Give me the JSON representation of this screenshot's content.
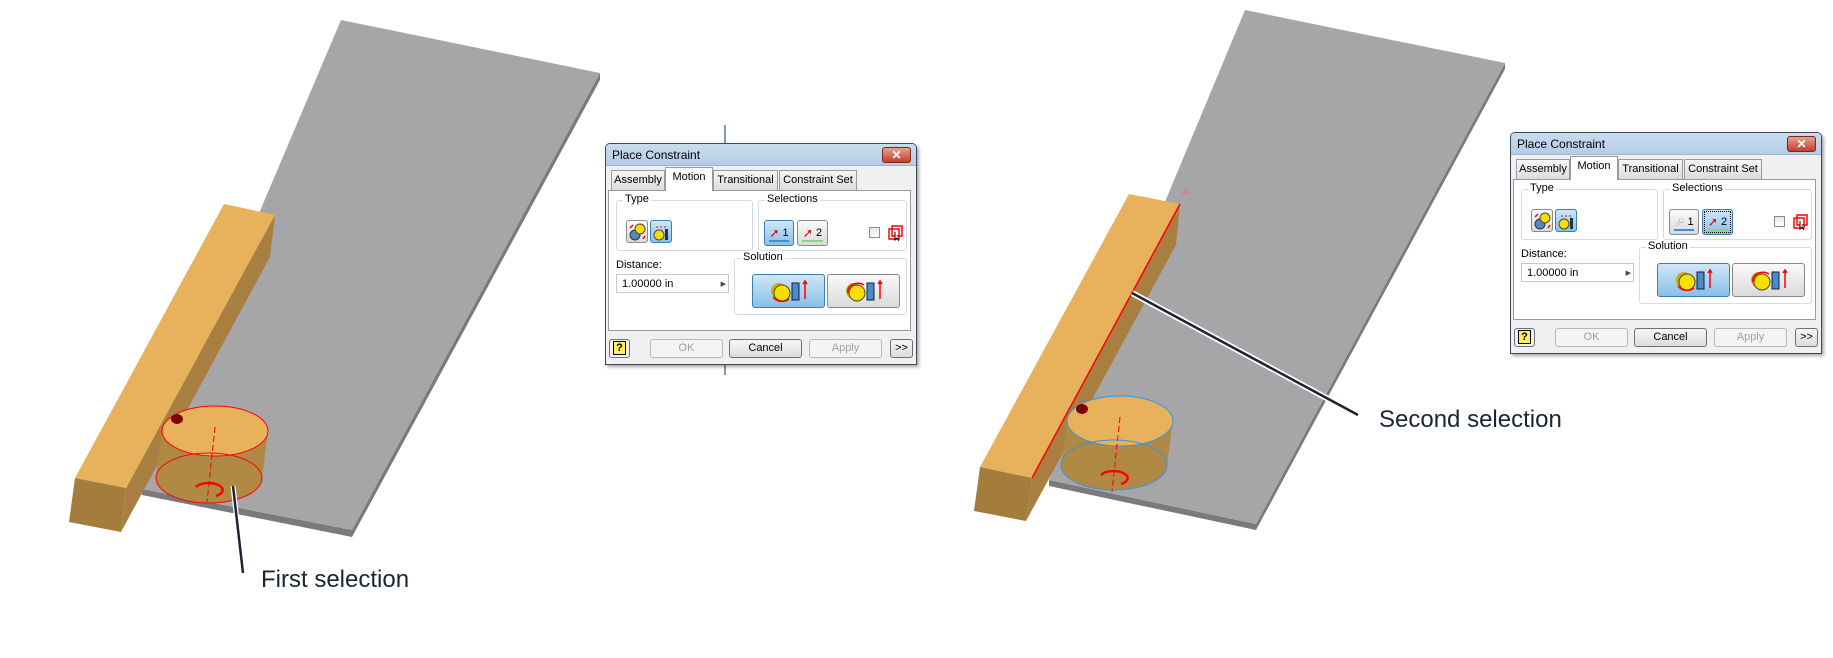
{
  "captions": {
    "first": "First selection",
    "second": "Second selection"
  },
  "colors": {
    "plate": "#a6a6a8",
    "bar_top": "#e8b25c",
    "bar_side": "#a87f40",
    "selection_red": "#ff0000",
    "preselect_blue": "#3b8fe0",
    "title_bar": "#b9d1ea"
  },
  "dialogs": [
    {
      "title": "Place Constraint",
      "close_icon": "close-x-icon",
      "tabs": [
        {
          "label": "Assembly"
        },
        {
          "label": "Motion",
          "active": true
        },
        {
          "label": "Transitional"
        },
        {
          "label": "Constraint Set"
        }
      ],
      "type_label": "Type",
      "selections_label": "Selections",
      "sel1": "1",
      "sel2": "2",
      "active_selection": 1,
      "distance_label": "Distance:",
      "distance_value": "1.00000 in",
      "solution_label": "Solution",
      "active_solution": 1,
      "help": "?",
      "ok": "OK",
      "cancel": "Cancel",
      "apply": "Apply",
      "more": ">>"
    },
    {
      "title": "Place Constraint",
      "close_icon": "close-x-icon",
      "tabs": [
        {
          "label": "Assembly"
        },
        {
          "label": "Motion",
          "active": true
        },
        {
          "label": "Transitional"
        },
        {
          "label": "Constraint Set"
        }
      ],
      "type_label": "Type",
      "selections_label": "Selections",
      "sel1": "1",
      "sel2": "2",
      "active_selection": 2,
      "distance_label": "Distance:",
      "distance_value": "1.00000 in",
      "solution_label": "Solution",
      "active_solution": 1,
      "help": "?",
      "ok": "OK",
      "cancel": "Cancel",
      "apply": "Apply",
      "more": ">>"
    }
  ]
}
